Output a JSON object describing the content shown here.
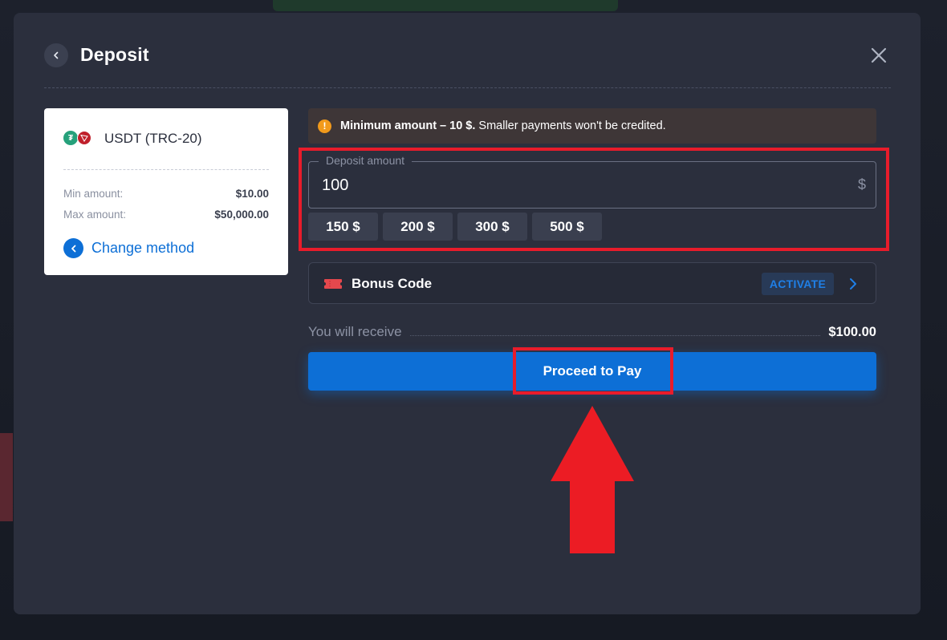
{
  "modal": {
    "title": "Deposit"
  },
  "method_card": {
    "name": "USDT (TRC-20)",
    "min_label": "Min amount:",
    "min_value": "$10.00",
    "max_label": "Max amount:",
    "max_value": "$50,000.00",
    "change_label": "Change method"
  },
  "warning": {
    "bold": "Minimum amount – 10 $.",
    "text": "Smaller payments won't be credited."
  },
  "deposit": {
    "legend": "Deposit amount",
    "value": "100",
    "currency": "$",
    "presets": [
      "150 $",
      "200 $",
      "300 $",
      "500 $"
    ]
  },
  "bonus": {
    "label": "Bonus Code",
    "activate": "ACTIVATE"
  },
  "receive": {
    "label": "You will receive",
    "value": "$100.00"
  },
  "proceed_label": "Proceed to Pay",
  "colors": {
    "accent": "#0d6fd6",
    "highlight": "#e81c2b",
    "warning": "#f29a1b",
    "modal_bg": "#2b2f3d"
  },
  "icons": [
    "chevron-left-icon",
    "close-icon",
    "tether-icon",
    "tron-icon",
    "warning-icon",
    "ticket-icon",
    "chevron-right-icon",
    "arrow-up-annotation"
  ]
}
